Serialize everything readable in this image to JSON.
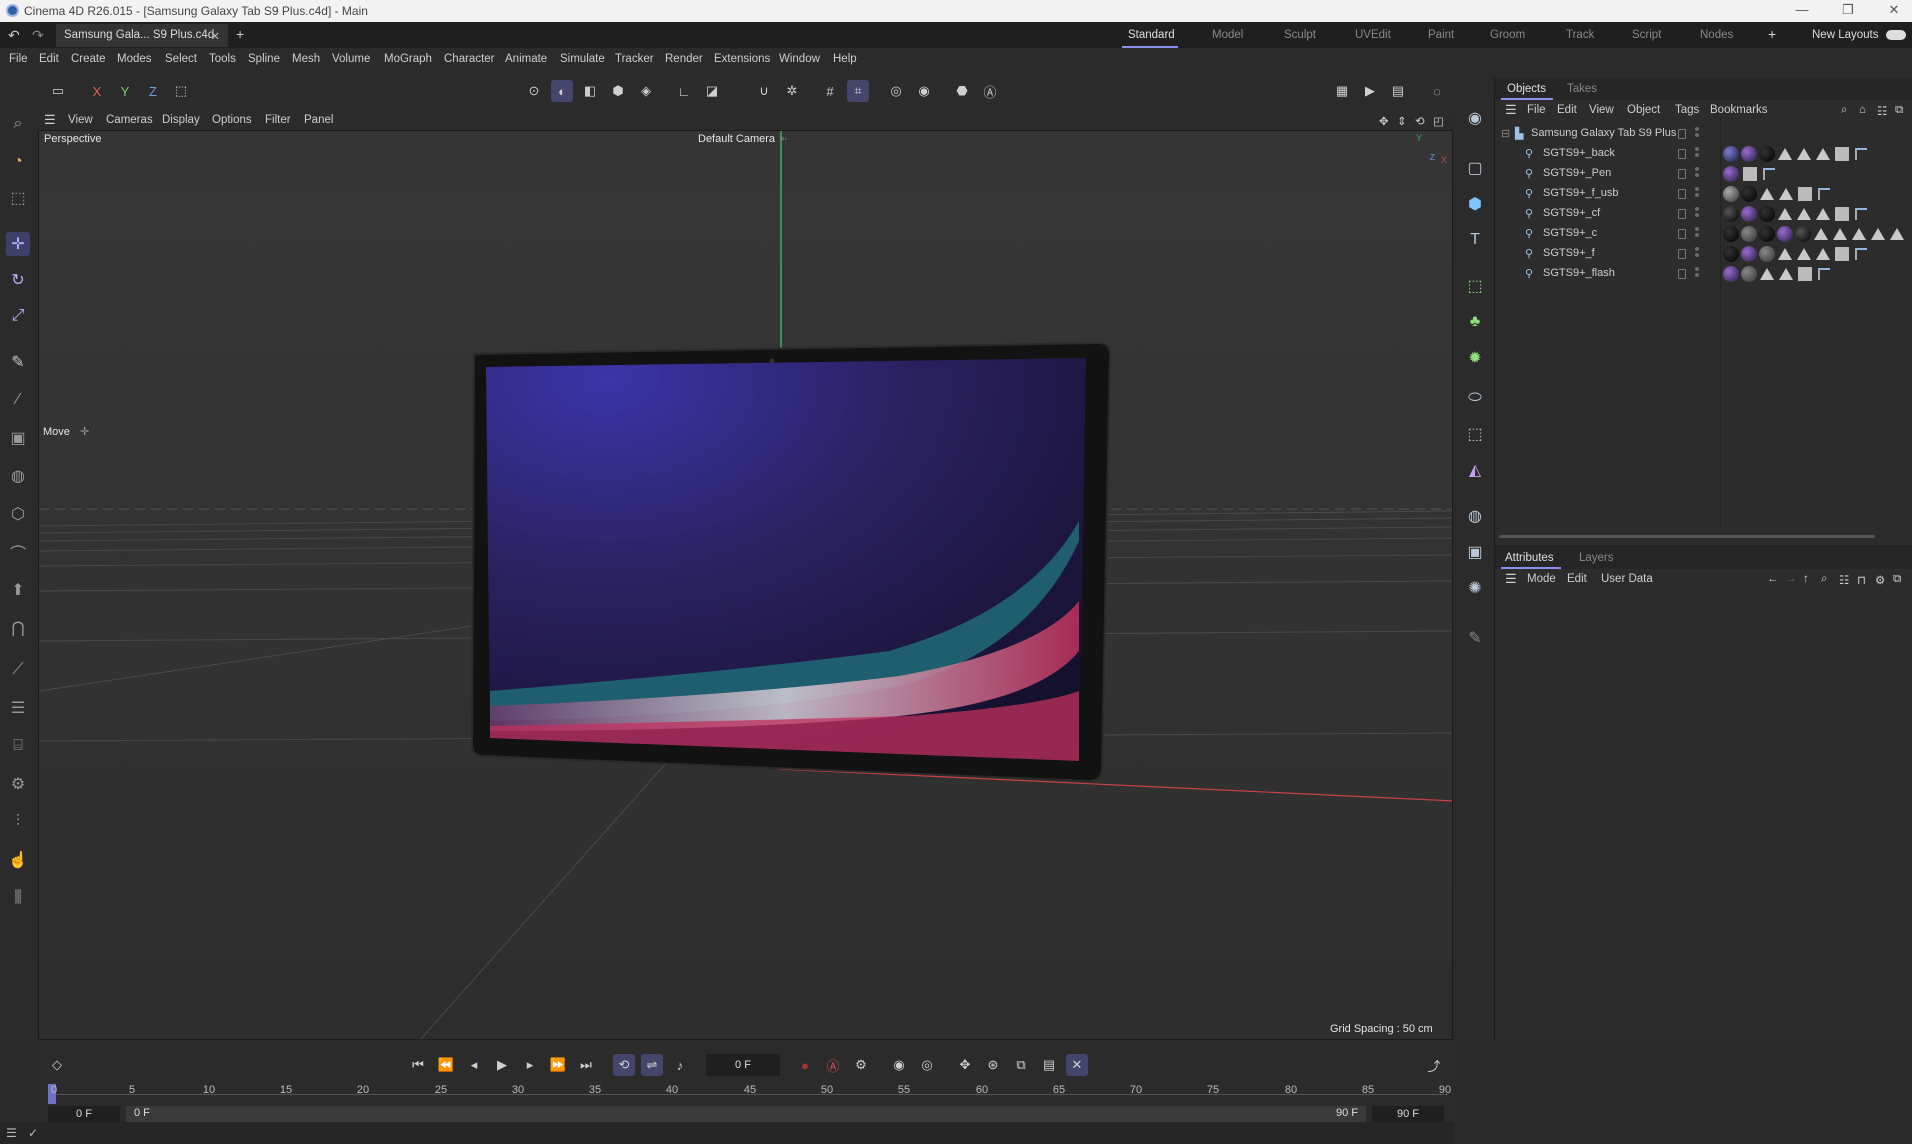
{
  "titlebar": {
    "title": "Cinema 4D R26.015 - [Samsung Galaxy Tab S9 Plus.c4d] - Main",
    "minimize": "—",
    "restore": "❐",
    "close": "✕"
  },
  "tabs": {
    "document": "Samsung Gala... S9 Plus.c4d",
    "close": "✕",
    "add": "+",
    "layouts": [
      "Standard",
      "Model",
      "Sculpt",
      "UVEdit",
      "Paint",
      "Groom",
      "Track",
      "Script",
      "Nodes"
    ],
    "active_layout": "Standard",
    "add_layout": "+",
    "new_layouts": "New Layouts"
  },
  "menubar": [
    "File",
    "Edit",
    "Create",
    "Modes",
    "Select",
    "Tools",
    "Spline",
    "Mesh",
    "Volume",
    "MoGraph",
    "Character",
    "Animate",
    "Simulate",
    "Tracker",
    "Render",
    "Extensions",
    "Window",
    "Help"
  ],
  "toolbar": {
    "axis_x": "X",
    "axis_y": "Y",
    "axis_z": "Z",
    "icons": [
      "undo-icon",
      "redo-icon",
      "lock-icon",
      "coord-icon",
      "snap-icon",
      "grid-icon",
      "render-icon"
    ]
  },
  "viewport": {
    "menus": [
      "View",
      "Cameras",
      "Display",
      "Options",
      "Filter",
      "Panel"
    ],
    "projection": "Perspective",
    "camera": "Default Camera",
    "camera_icon": "▫·",
    "tool_label": "Move",
    "tool_icon": "✛",
    "grid_spacing": "Grid Spacing : 50 cm",
    "axis_y": "Y",
    "axis_x": "X",
    "axis_z": "Z"
  },
  "objects_panel": {
    "tabs": [
      "Objects",
      "Takes"
    ],
    "active_tab": "Objects",
    "menus": [
      "File",
      "Edit",
      "View",
      "Object",
      "Tags",
      "Bookmarks"
    ],
    "root": "Samsung Galaxy Tab S9 Plus",
    "children": [
      "SGTS9+_back",
      "SGTS9+_Pen",
      "SGTS9+_f_usb",
      "SGTS9+_cf",
      "SGTS9+_c",
      "SGTS9+_f",
      "SGTS9+_flash"
    ]
  },
  "attributes_panel": {
    "tabs": [
      "Attributes",
      "Layers"
    ],
    "active_tab": "Attributes",
    "menus": [
      "Mode",
      "Edit",
      "User Data"
    ]
  },
  "timeline": {
    "current_frame": "0 F",
    "start_field": "0 F",
    "start_field_inner": "0 F",
    "end_field_inner": "90 F",
    "end_field": "90 F",
    "ticks": [
      "0",
      "5",
      "10",
      "15",
      "20",
      "25",
      "30",
      "35",
      "40",
      "45",
      "50",
      "55",
      "60",
      "65",
      "70",
      "75",
      "80",
      "85",
      "90"
    ]
  },
  "colors": {
    "accent": "#8a8ff0",
    "selected_bg": "#43456b",
    "axis_green": "#3fae5a",
    "axis_red": "#c94040"
  }
}
